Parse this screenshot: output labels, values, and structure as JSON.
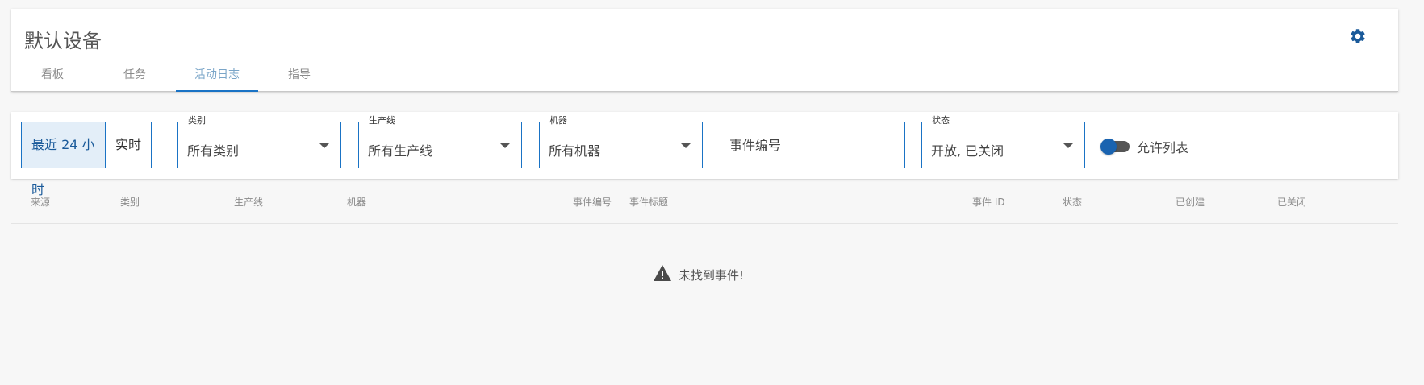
{
  "header": {
    "title": "默认设备",
    "settings_icon": "gear-icon",
    "tabs": [
      {
        "label": "看板",
        "active": false
      },
      {
        "label": "任务",
        "active": false
      },
      {
        "label": "活动日志",
        "active": true
      },
      {
        "label": "指导",
        "active": false
      }
    ],
    "accent_color": "#1a73c5"
  },
  "filters": {
    "range": {
      "last24": "最近 24 小时",
      "realtime": "实时",
      "selected": "最近 24 小时"
    },
    "category": {
      "label": "类别",
      "value": "所有类别"
    },
    "production_line": {
      "label": "生产线",
      "value": "所有生产线"
    },
    "machine": {
      "label": "机器",
      "value": "所有机器"
    },
    "event_number": {
      "placeholder": "事件编号",
      "value": ""
    },
    "status": {
      "label": "状态",
      "value": "开放, 已关闭"
    },
    "allow_list": {
      "label": "允许列表",
      "enabled": false
    }
  },
  "table": {
    "columns": [
      "来源",
      "类别",
      "生产线",
      "机器",
      "事件编号",
      "事件标题",
      "事件 ID",
      "状态",
      "已创建",
      "已关闭"
    ]
  },
  "empty_state": {
    "icon": "warning-icon",
    "text": "未找到事件!"
  }
}
